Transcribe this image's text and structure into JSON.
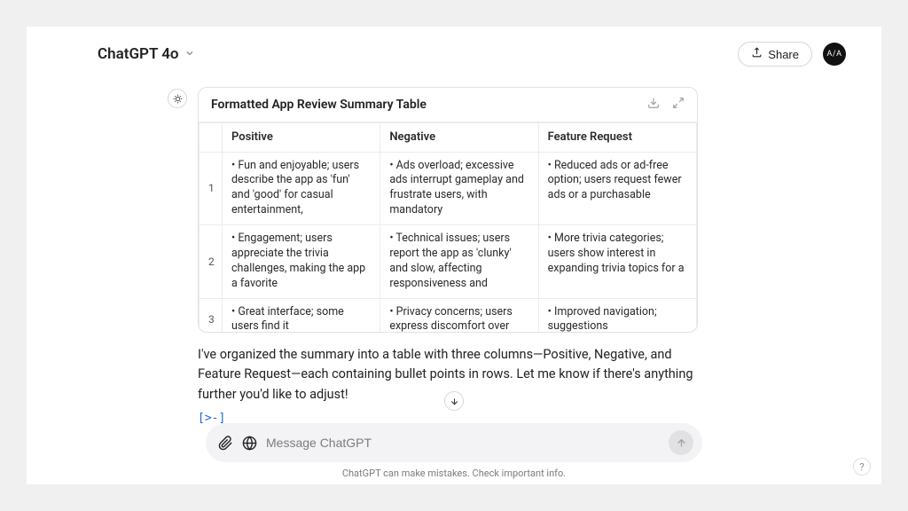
{
  "header": {
    "model_label": "ChatGPT 4o",
    "share_label": "Share",
    "avatar_text": "A/A"
  },
  "card": {
    "title": "Formatted App Review Summary Table",
    "columns": [
      "Positive",
      "Negative",
      "Feature Request"
    ],
    "rows": [
      {
        "num": "1",
        "positive": "• Fun and enjoyable; users describe the app as 'fun' and 'good' for casual entertainment,",
        "negative": "• Ads overload; excessive ads interrupt gameplay and frustrate users, with mandatory",
        "feature": "• Reduced ads or ad-free option; users request fewer ads or a purchasable"
      },
      {
        "num": "2",
        "positive": "• Engagement; users appreciate the trivia challenges, making the app a favorite",
        "negative": "• Technical issues; users report the app as 'clunky' and slow, affecting responsiveness and",
        "feature": "• More trivia categories; users show interest in expanding trivia topics for a"
      },
      {
        "num": "3",
        "positive": "• Great interface; some users find it",
        "negative": "• Privacy concerns; users express discomfort over",
        "feature": "• Improved navigation; suggestions"
      }
    ]
  },
  "message": {
    "text": "I've organized the summary into a table with three columns—Positive, Negative, and Feature Request—each containing bullet points in rows. Let me know if there's anything further you'd like to adjust!",
    "code_link": "[>-]"
  },
  "composer": {
    "placeholder": "Message ChatGPT"
  },
  "footer": {
    "disclaimer": "ChatGPT can make mistakes. Check important info.",
    "help": "?"
  }
}
